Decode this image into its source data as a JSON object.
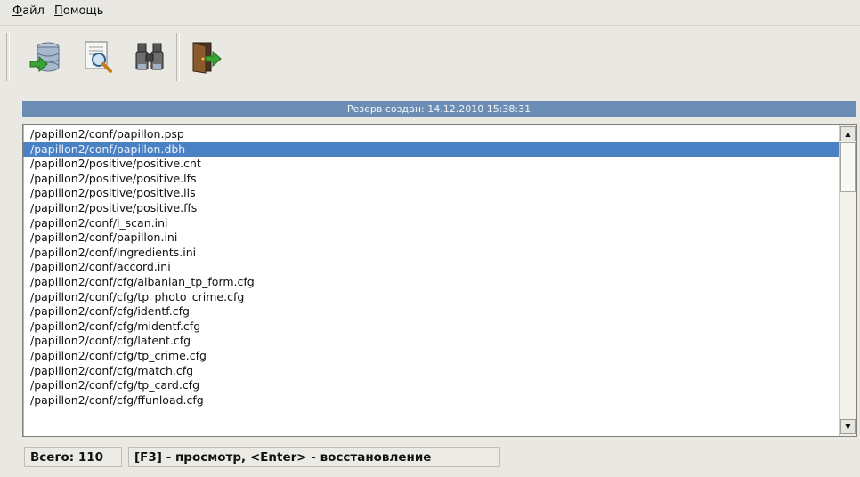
{
  "menu": {
    "file": "Файл",
    "file_accel": "Ф",
    "file_rest": "айл",
    "help": "Помощь",
    "help_accel": "П",
    "help_rest": "омощь"
  },
  "toolbar": {
    "buttons": [
      {
        "icon": "database-restore-icon"
      },
      {
        "icon": "document-preview-icon"
      },
      {
        "icon": "binoculars-search-icon"
      },
      {
        "icon": "exit-door-icon"
      }
    ]
  },
  "backup_header": "Резерв создан: 14.12.2010 15:38:31",
  "files": [
    "/papillon2/conf/papillon.psp",
    "/papillon2/conf/papillon.dbh",
    "/papillon2/positive/positive.cnt",
    "/papillon2/positive/positive.lfs",
    "/papillon2/positive/positive.lls",
    "/papillon2/positive/positive.ffs",
    "/papillon2/conf/l_scan.ini",
    "/papillon2/conf/papillon.ini",
    "/papillon2/conf/ingredients.ini",
    "/papillon2/conf/accord.ini",
    "/papillon2/conf/cfg/albanian_tp_form.cfg",
    "/papillon2/conf/cfg/tp_photo_crime.cfg",
    "/papillon2/conf/cfg/identf.cfg",
    "/papillon2/conf/cfg/midentf.cfg",
    "/papillon2/conf/cfg/latent.cfg",
    "/papillon2/conf/cfg/tp_crime.cfg",
    "/papillon2/conf/cfg/match.cfg",
    "/papillon2/conf/cfg/tp_card.cfg",
    "/papillon2/conf/cfg/ffunload.cfg"
  ],
  "selected_index": 1,
  "status": {
    "total": "Всего: 110",
    "hint": "[F3] - просмотр, <Enter> - восстановление"
  },
  "colors": {
    "selection": "#4a81c4",
    "header": "#6c8eb4",
    "window_bg": "#e9e8e2"
  }
}
